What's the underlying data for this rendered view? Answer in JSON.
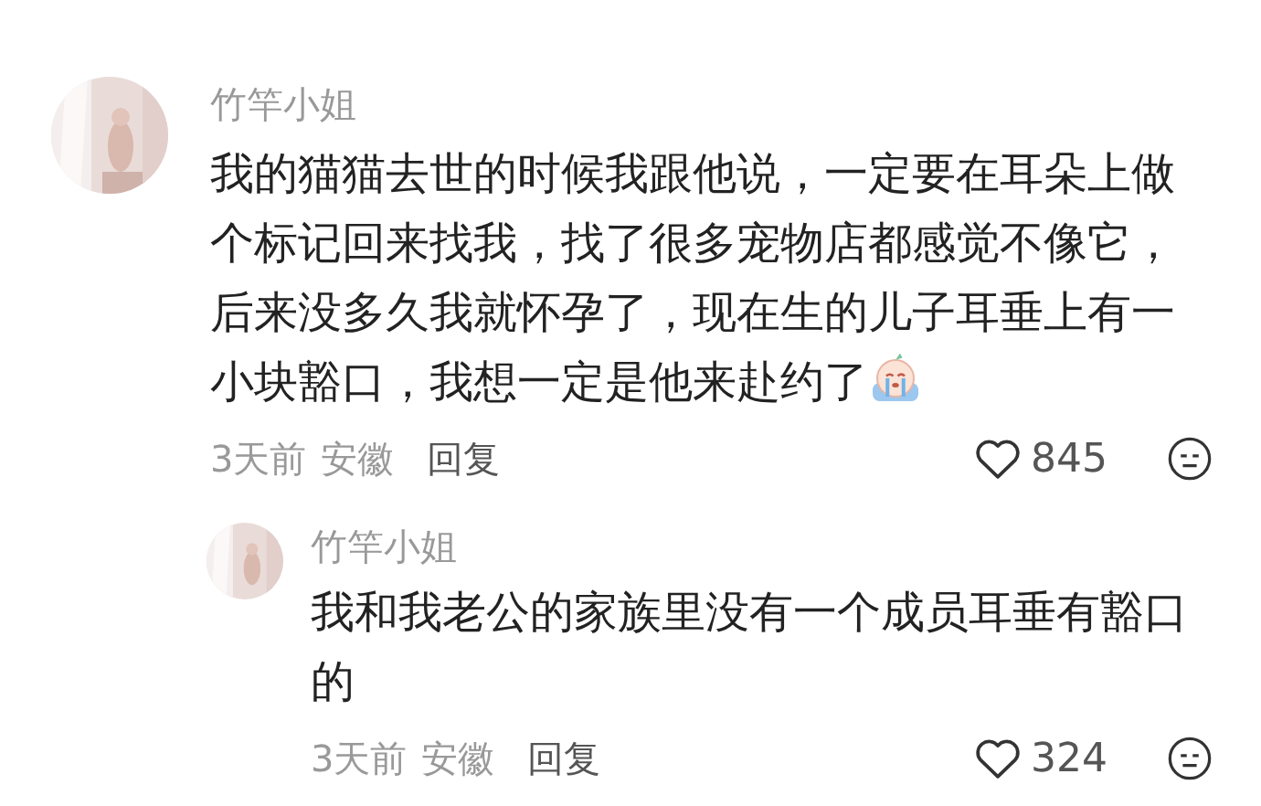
{
  "comments": [
    {
      "author": "竹竿小姐",
      "text": "我的猫猫去世的时候我跟他说，一定要在耳朵上做个标记回来找我，找了很多宠物店都感觉不像它，后来没多久我就怀孕了，现在生的儿子耳垂上有一小块豁口，我想一定是他来赴约了",
      "has_emoji": true,
      "time": "3天前",
      "location": "安徽",
      "reply_label": "回复",
      "likes": "845",
      "replies": [
        {
          "author": "竹竿小姐",
          "text": "我和我老公的家族里没有一个成员耳垂有豁口的",
          "time": "3天前",
          "location": "安徽",
          "reply_label": "回复",
          "likes": "324"
        }
      ]
    }
  ]
}
